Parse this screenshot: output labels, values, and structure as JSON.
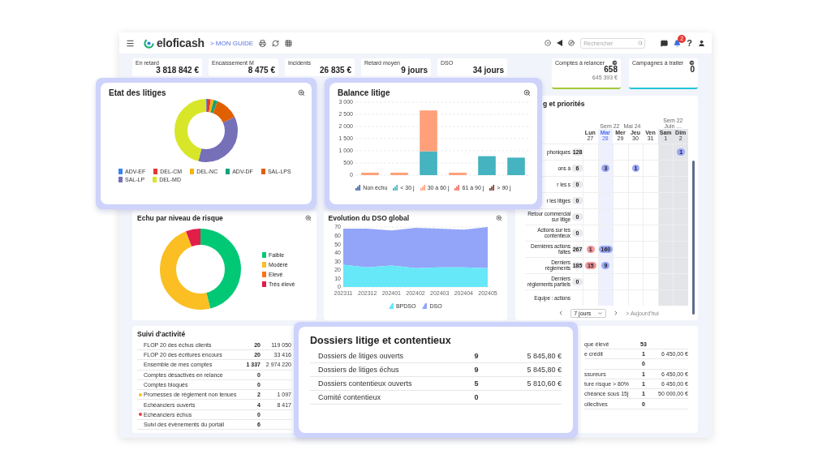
{
  "topbar": {
    "logo": "eloficash",
    "guide_link": "> MON GUIDE",
    "search": {
      "placeholder": "Rechercher"
    },
    "notification_count": "2",
    "help": "?"
  },
  "kpis": [
    {
      "label": "En retard",
      "value": "3 818 842 €"
    },
    {
      "label": "Encaissement M",
      "value": "8 475 €"
    },
    {
      "label": "Incidents",
      "value": "26 835 €"
    },
    {
      "label": "Retard moyen",
      "value": "9 jours"
    },
    {
      "label": "DSO",
      "value": "34 jours"
    }
  ],
  "side_kpis": [
    {
      "label": "Comptes à relancer",
      "value": "658",
      "sub": "645 393 €",
      "color": "#a3c93a"
    },
    {
      "label": "Campagnes à traiter",
      "value": "0",
      "color": "#22c5d8"
    }
  ],
  "planning": {
    "title": "g et priorités",
    "weeks": [
      {
        "week": "Sem 22",
        "month": "Mai 24"
      },
      {
        "week": "Sem 22",
        "month": "Juin …"
      }
    ],
    "days": [
      {
        "name": "Lun",
        "date": "27",
        "selected": false,
        "weekend": false
      },
      {
        "name": "Mar",
        "date": "28",
        "selected": true,
        "weekend": false
      },
      {
        "name": "Mer",
        "date": "29",
        "selected": false,
        "weekend": false
      },
      {
        "name": "Jeu",
        "date": "30",
        "selected": false,
        "weekend": false
      },
      {
        "name": "Ven",
        "date": "31",
        "selected": false,
        "weekend": false
      },
      {
        "name": "Sam",
        "date": "1",
        "selected": false,
        "weekend": true
      },
      {
        "name": "Dim",
        "date": "2",
        "selected": false,
        "weekend": true
      }
    ],
    "rows": [
      {
        "label": "phoniques",
        "count": "128",
        "cells": [
          null,
          null,
          null,
          null,
          null,
          null,
          {
            "text": "1",
            "color": "#9aa8f5"
          }
        ]
      },
      {
        "label": "ons à",
        "count": "6",
        "cells": [
          null,
          {
            "text": "3",
            "color": "#9aa8f5"
          },
          null,
          {
            "text": "1",
            "color": "#9aa8f5"
          },
          null,
          null,
          null
        ]
      },
      {
        "label": "r les s",
        "count": "0"
      },
      {
        "label": "r les litiges",
        "count": "0"
      },
      {
        "label": "Retour commercial sur litige",
        "count": "0"
      },
      {
        "label": "Actions sur les contentieux",
        "count": "0"
      },
      {
        "label": "Dernières actions faites",
        "count": "267",
        "cells": [
          {
            "text": "1",
            "color": "#f0989c"
          },
          {
            "text": "160",
            "color": "#9aa8f5"
          },
          null,
          null,
          null,
          null,
          null
        ]
      },
      {
        "label": "Derniers règlements",
        "count": "185",
        "cells": [
          {
            "text": "15",
            "color": "#f0989c"
          },
          {
            "text": "9",
            "color": "#9aa8f5"
          },
          null,
          null,
          null,
          null,
          null
        ]
      },
      {
        "label": "Derniers règlements partiels",
        "count": "0"
      },
      {
        "label": "Equipe : actions"
      }
    ],
    "range": "7 jours",
    "today": "> Aujourd'hui"
  },
  "etat_litiges": {
    "title": "Etat des litiges",
    "legend": [
      {
        "label": "ADV-EF",
        "color": "#3b82f6"
      },
      {
        "label": "DEL-CM",
        "color": "#e53935"
      },
      {
        "label": "DEL-NC",
        "color": "#f6b400"
      },
      {
        "label": "ADV-DF",
        "color": "#12a37a"
      },
      {
        "label": "SAL-LPS",
        "color": "#e06000"
      },
      {
        "label": "SAL-LP",
        "color": "#7570b8"
      },
      {
        "label": "DEL-MD",
        "color": "#d8e62a"
      }
    ]
  },
  "balance_litige": {
    "title": "Balance litige",
    "chart_data": {
      "type": "bar",
      "stacked": true,
      "grid": true,
      "ylim": [
        0,
        3000
      ],
      "yticks": [
        0,
        500,
        {
          "value": 1000,
          "label": "1 000"
        },
        {
          "value": 1500,
          "label": "1 500"
        },
        {
          "value": 2000,
          "label": "2 000"
        },
        {
          "value": 2500,
          "label": "2 500"
        },
        {
          "value": 3000,
          "label": "3 000"
        }
      ],
      "series": [
        {
          "name": "Non échu",
          "color": "#3b5fa8",
          "values": [
            0,
            0,
            0,
            0,
            0,
            0
          ]
        },
        {
          "name": "< 30 j",
          "color": "#45b3c0",
          "values": [
            0,
            0,
            980,
            0,
            780,
            720
          ]
        },
        {
          "name": "30 à 60 j",
          "color": "#ffa07a",
          "values": [
            100,
            100,
            1680,
            100,
            0,
            0
          ]
        },
        {
          "name": "61 à 90 j",
          "color": "#f06a5a",
          "values": [
            0,
            0,
            0,
            0,
            0,
            0
          ]
        },
        {
          "name": "> 90 j",
          "color": "#7a3b30",
          "values": [
            0,
            0,
            0,
            0,
            0,
            0
          ]
        }
      ]
    }
  },
  "risque": {
    "title": "Echu par niveau de risque",
    "legend": [
      {
        "label": "Faible",
        "color": "#00c875"
      },
      {
        "label": "Modéré",
        "color": "#fbbf24"
      },
      {
        "label": "Elevé",
        "color": "#f97316"
      },
      {
        "label": "Très élevé",
        "color": "#e11d48"
      }
    ]
  },
  "dso": {
    "title": "Evolution du DSO global",
    "chart_data": {
      "type": "area",
      "grid": true,
      "x": [
        "202311",
        "202312",
        "202401",
        "202402",
        "202403",
        "202404",
        "202405"
      ],
      "ylim": [
        0,
        70
      ],
      "yticks": [
        0,
        10,
        20,
        30,
        40,
        50,
        60,
        70
      ],
      "series": [
        {
          "name": "BPDSO",
          "color": "#67e8f9",
          "values": [
            26,
            23,
            25,
            22,
            23,
            23,
            22
          ]
        },
        {
          "name": "DSO",
          "color": "#93a5f8",
          "values": [
            68,
            68,
            66,
            69,
            68,
            67,
            70
          ]
        }
      ]
    }
  },
  "suivi": {
    "title": "Suivi d'activité",
    "rows": [
      {
        "label": "FLOP 20 des échus clients",
        "count": "20",
        "amount": "119 050"
      },
      {
        "label": "FLOP 20 des écritures encours",
        "count": "20",
        "amount": "33 416"
      },
      {
        "label": "Ensemble de mes comptes",
        "count": "1 337",
        "amount": "2 974 220"
      },
      {
        "label": "Comptes désactivés en relance",
        "count": "0"
      },
      {
        "label": "Comptes bloqués",
        "count": "0"
      },
      {
        "label": "Promesses de règlement non tenues",
        "count": "2",
        "amount": "1 097",
        "color": "#fbbf24"
      },
      {
        "label": "Echéanciers ouverts",
        "count": "4",
        "amount": "8 417"
      },
      {
        "label": "Echéanciers échus",
        "count": "0",
        "color": "#e53e3e"
      },
      {
        "label": "Suivi des évènements du portail",
        "count": "6"
      }
    ],
    "right_rows": [
      {
        "label": "que élevé",
        "count": "53"
      },
      {
        "label": "e crédit",
        "count": "1",
        "amount": "6 450,00 €"
      },
      {
        "count": "0"
      },
      {
        "label": "ssureurs",
        "count": "1",
        "amount": "6 450,00 €"
      },
      {
        "label": "ture risque > 80%",
        "count": "1",
        "amount": "6 450,00 €"
      },
      {
        "label": "chéance sous 15j",
        "count": "1",
        "amount": "50 000,00 €"
      },
      {
        "label": "ollectives",
        "count": "0"
      }
    ]
  },
  "dossiers": {
    "title": "Dossiers litige et contentieux",
    "rows": [
      {
        "label": "Dossiers de litiges ouverts",
        "count": "9",
        "amount": "5 845,80 €"
      },
      {
        "label": "Dossiers de litiges échus",
        "count": "9",
        "amount": "5 845,80 €"
      },
      {
        "label": "Dossiers contentieux ouverts",
        "count": "5",
        "amount": "5 810,60 €"
      },
      {
        "label": "Comité contentieux",
        "count": "0"
      }
    ]
  }
}
